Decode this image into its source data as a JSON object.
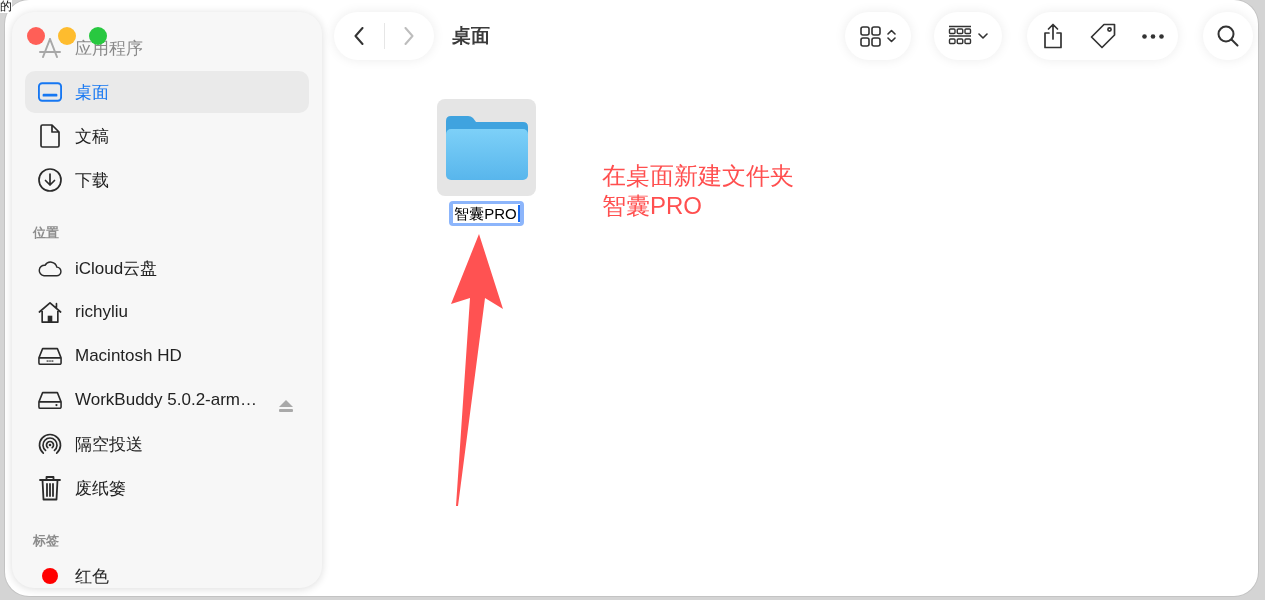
{
  "desktop": {
    "background_text": "的"
  },
  "sidebar": {
    "sections": [
      {
        "items": [
          {
            "kind": "apps",
            "label": "应用程序",
            "dimmed": true,
            "selected": false
          },
          {
            "kind": "desktop",
            "label": "桌面",
            "dimmed": false,
            "selected": true
          },
          {
            "kind": "document",
            "label": "文稿",
            "dimmed": false,
            "selected": false
          },
          {
            "kind": "download",
            "label": "下载",
            "dimmed": false,
            "selected": false
          }
        ]
      },
      {
        "title": "位置",
        "items": [
          {
            "kind": "cloud",
            "label": "iCloud云盘",
            "dimmed": false,
            "selected": false,
            "ejectable": false
          },
          {
            "kind": "home",
            "label": "richyliu",
            "dimmed": false,
            "selected": false,
            "ejectable": false
          },
          {
            "kind": "disk",
            "label": "Macintosh HD",
            "dimmed": false,
            "selected": false,
            "ejectable": false
          },
          {
            "kind": "volume",
            "label": "WorkBuddy 5.0.2-arm…",
            "dimmed": false,
            "selected": false,
            "ejectable": true
          },
          {
            "kind": "airdrop",
            "label": "隔空投送",
            "dimmed": false,
            "selected": false,
            "ejectable": false
          },
          {
            "kind": "trash",
            "label": "废纸篓",
            "dimmed": false,
            "selected": false,
            "ejectable": false
          }
        ]
      },
      {
        "title": "标签",
        "items": [
          {
            "kind": "tag",
            "label": "红色",
            "color": "#ff0000",
            "dimmed": false,
            "selected": false
          }
        ]
      }
    ]
  },
  "toolbar": {
    "back": {
      "disabled": false
    },
    "forward": {
      "disabled": true
    },
    "title": "桌面"
  },
  "content": {
    "items": [
      {
        "kind": "folder",
        "name": "智囊PRO",
        "selected": true,
        "editing": true
      }
    ],
    "annotation": {
      "lines": [
        "在桌面新建文件夹",
        "智囊PRO"
      ]
    }
  }
}
